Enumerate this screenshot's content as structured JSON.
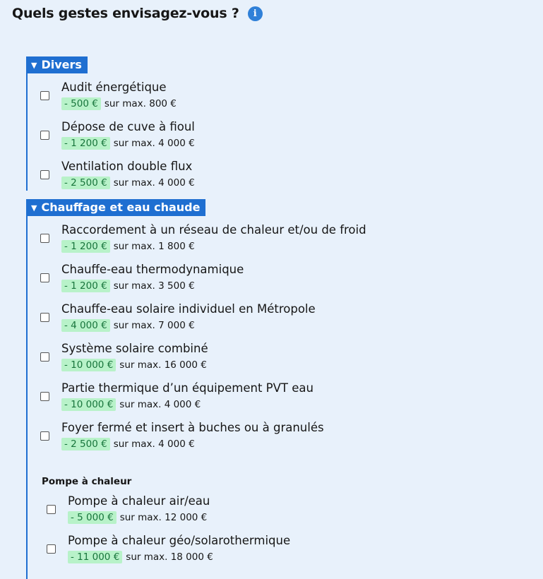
{
  "header": {
    "title": "Quels gestes envisagez-vous ?",
    "info_icon": "info-icon"
  },
  "sections": [
    {
      "label": "Divers",
      "toggle_icon": "triangle-down-icon",
      "items": [
        {
          "label": "Audit énergétique",
          "badge": "- 500 €",
          "max": "sur max. 800 €"
        },
        {
          "label": "Dépose de cuve à fioul",
          "badge": "- 1 200 €",
          "max": "sur max. 4 000 €"
        },
        {
          "label": "Ventilation double flux",
          "badge": "- 2 500 €",
          "max": "sur max. 4 000 €"
        }
      ]
    },
    {
      "label": "Chauffage et eau chaude",
      "toggle_icon": "triangle-down-icon",
      "items": [
        {
          "label": "Raccordement à un réseau de chaleur et/ou de froid",
          "badge": "- 1 200 €",
          "max": "sur max. 1 800 €"
        },
        {
          "label": "Chauffe-eau thermodynamique",
          "badge": "- 1 200 €",
          "max": "sur max. 3 500 €"
        },
        {
          "label": "Chauffe-eau solaire individuel en Métropole",
          "badge": "- 4 000 €",
          "max": "sur max. 7 000 €"
        },
        {
          "label": "Système solaire combiné",
          "badge": "- 10 000 €",
          "max": "sur max. 16 000 €"
        },
        {
          "label": "Partie thermique d’un équipement PVT eau",
          "badge": "- 10 000 €",
          "max": "sur max. 4 000 €"
        },
        {
          "label": "Foyer fermé et insert à buches ou à granulés",
          "badge": "- 2 500 €",
          "max": "sur max. 4 000 €"
        }
      ],
      "subgroup": {
        "title": "Pompe à chaleur",
        "items": [
          {
            "label": "Pompe à chaleur air/eau",
            "badge": "- 5 000 €",
            "max": "sur max. 12 000 €"
          },
          {
            "label": "Pompe à chaleur géo/solarothermique",
            "badge": "- 11 000 €",
            "max": "sur max. 18 000 €"
          }
        ]
      }
    }
  ],
  "colors": {
    "background": "#e8f1fb",
    "accent": "#1f6fd1",
    "badge_bg": "#b8f2c9",
    "badge_text": "#18753c"
  }
}
